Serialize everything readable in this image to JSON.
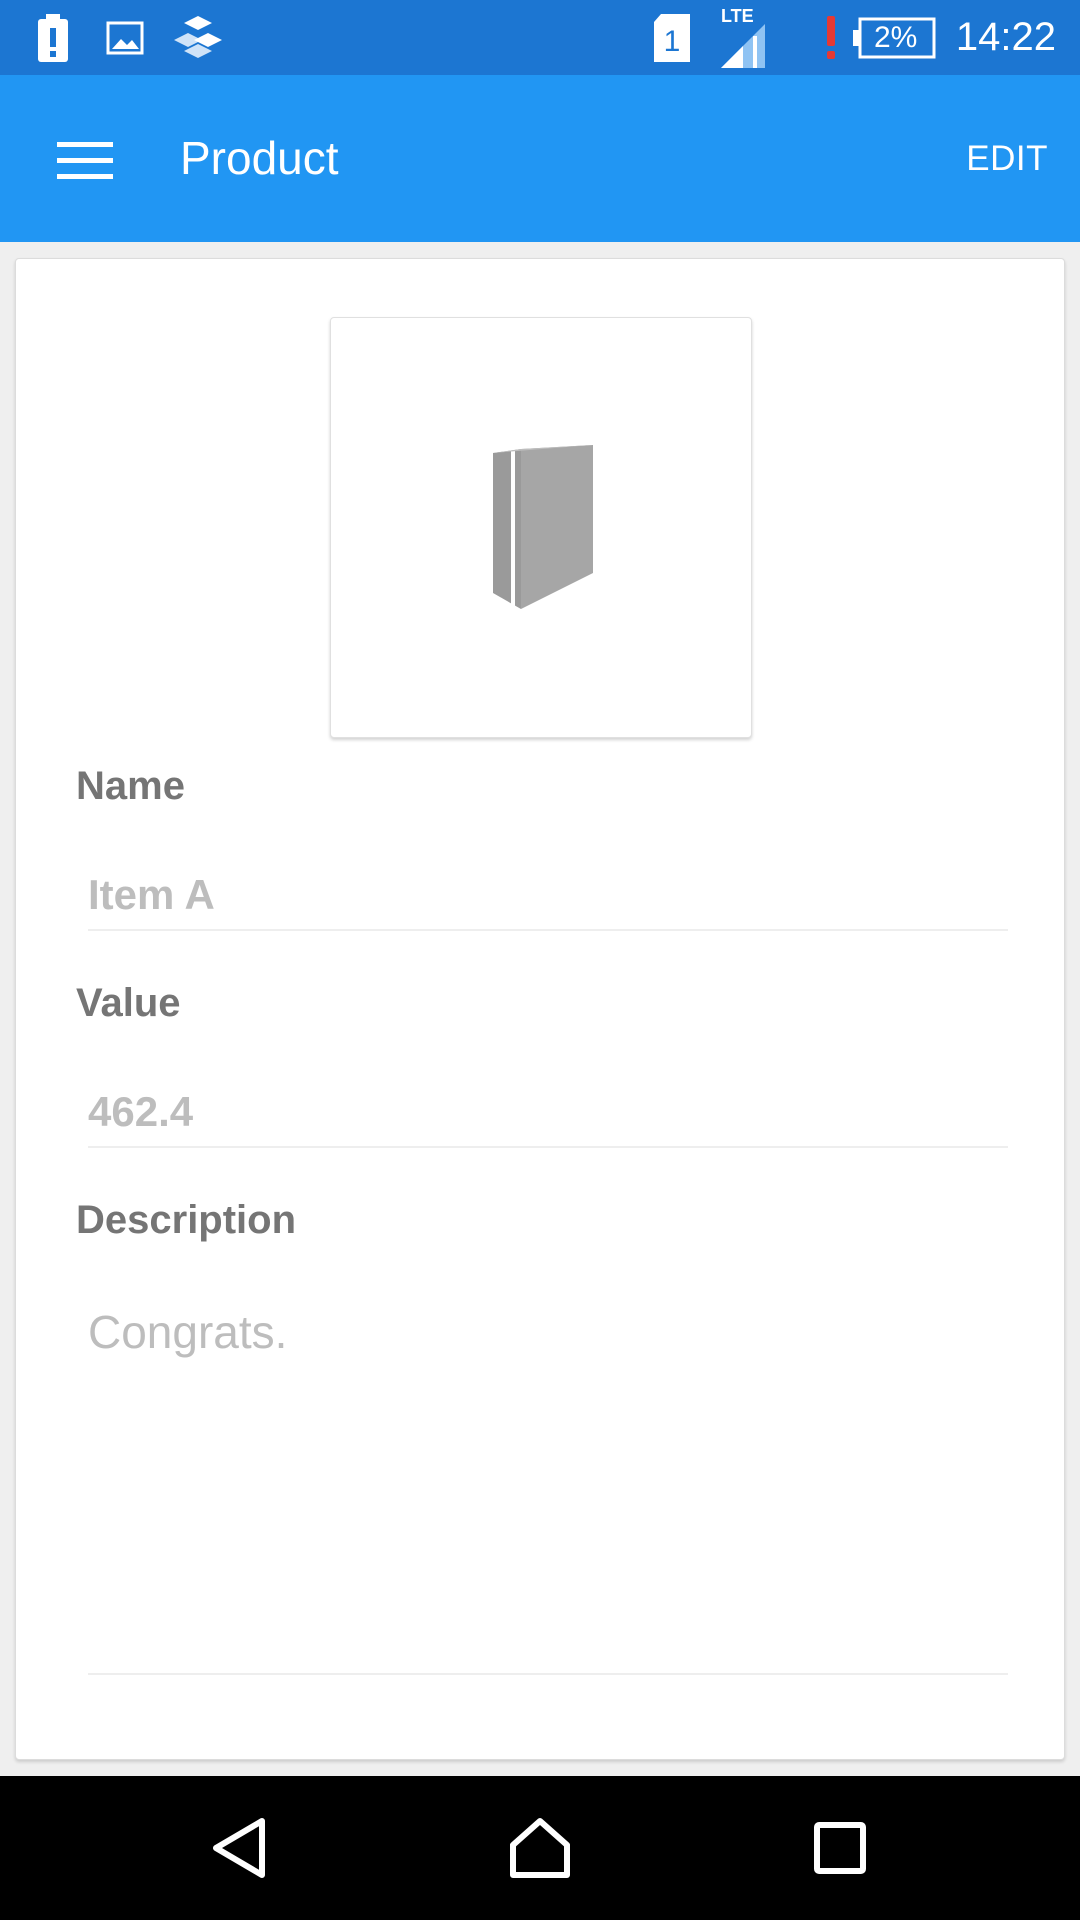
{
  "status_bar": {
    "time": "14:22",
    "battery_percent": "2%",
    "network": "LTE",
    "sim": "1",
    "icons": [
      "battery-alert-icon",
      "image-icon",
      "app-icon",
      "sim-icon",
      "signal-icon",
      "alert-icon",
      "battery-icon"
    ]
  },
  "app_bar": {
    "title": "Product",
    "edit_label": "EDIT",
    "menu_icon": "menu-icon"
  },
  "product": {
    "image_icon": "box-icon",
    "name_label": "Name",
    "name_value": "Item A",
    "value_label": "Value",
    "value_value": "462.4",
    "description_label": "Description",
    "description_value": "Congrats."
  },
  "nav_bar": {
    "icons": [
      "back-icon",
      "home-icon",
      "recents-icon"
    ]
  },
  "colors": {
    "status_bar": "#1c76d2",
    "app_bar": "#2196f3",
    "label": "#757575",
    "value": "#bdbdbd",
    "alert": "#e53935"
  }
}
